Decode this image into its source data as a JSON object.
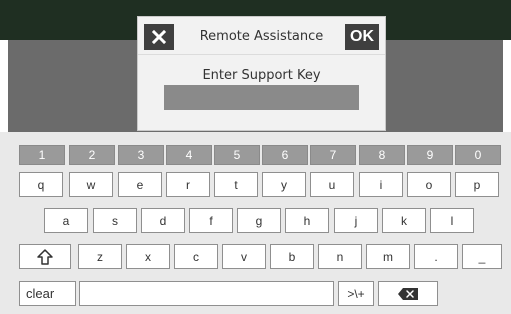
{
  "dialog": {
    "title": "Remote Assistance",
    "ok_label": "OK",
    "prompt": "Enter Support Key",
    "input_value": "",
    "close_icon": "close-icon"
  },
  "keyboard": {
    "numbers": [
      "1",
      "2",
      "3",
      "4",
      "5",
      "6",
      "7",
      "8",
      "9",
      "0"
    ],
    "row1": [
      "q",
      "w",
      "e",
      "r",
      "t",
      "y",
      "u",
      "i",
      "o",
      "p"
    ],
    "row2": [
      "a",
      "s",
      "d",
      "f",
      "g",
      "h",
      "j",
      "k",
      "l"
    ],
    "row3": [
      "z",
      "x",
      "c",
      "v",
      "b",
      "n",
      "m",
      ".",
      "_"
    ],
    "bottom": {
      "clear": "clear",
      "symbols": ">\\+",
      "space": ""
    },
    "icons": {
      "shift": "shift-icon",
      "backspace": "backspace-icon"
    }
  },
  "colors": {
    "top_band": "#1f2f22",
    "bg_panel": "#6b6b6b",
    "dialog_bg": "#f2f2f2",
    "button_dark": "#3f3f3f",
    "input_bg": "#8a8a8a",
    "keyboard_bg": "#e9e9e9",
    "numkey_bg": "#9a9a9a",
    "key_border": "#8f8f8f"
  }
}
